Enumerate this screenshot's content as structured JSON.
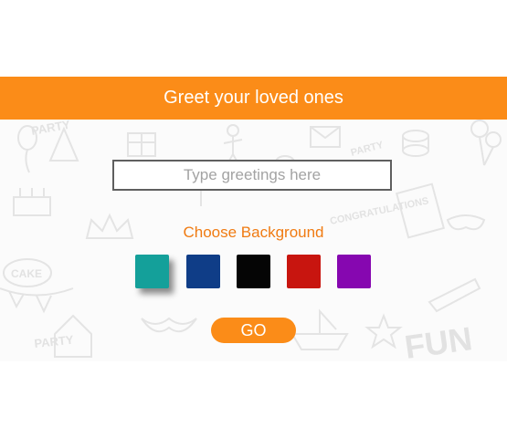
{
  "header": {
    "title": "Greet your loved ones",
    "color": "#fb8c18"
  },
  "greeting_input": {
    "value": "",
    "placeholder": "Type greetings here"
  },
  "background_picker": {
    "label": "Choose Background",
    "label_color": "#f07b12",
    "selected_index": 0,
    "colors": [
      {
        "name": "teal",
        "hex": "#14a09a"
      },
      {
        "name": "navy",
        "hex": "#0f3d87"
      },
      {
        "name": "black",
        "hex": "#050505"
      },
      {
        "name": "red",
        "hex": "#c8150f"
      },
      {
        "name": "purple",
        "hex": "#8607b0"
      }
    ]
  },
  "go_button": {
    "label": "GO",
    "color": "#fb8c18"
  },
  "background_doodles": {
    "words": [
      "PARTY",
      "PARTY",
      "FUN",
      "CAKE",
      "CONGRATULATIONS",
      "PARTY"
    ],
    "color": "#e6e6e6"
  }
}
